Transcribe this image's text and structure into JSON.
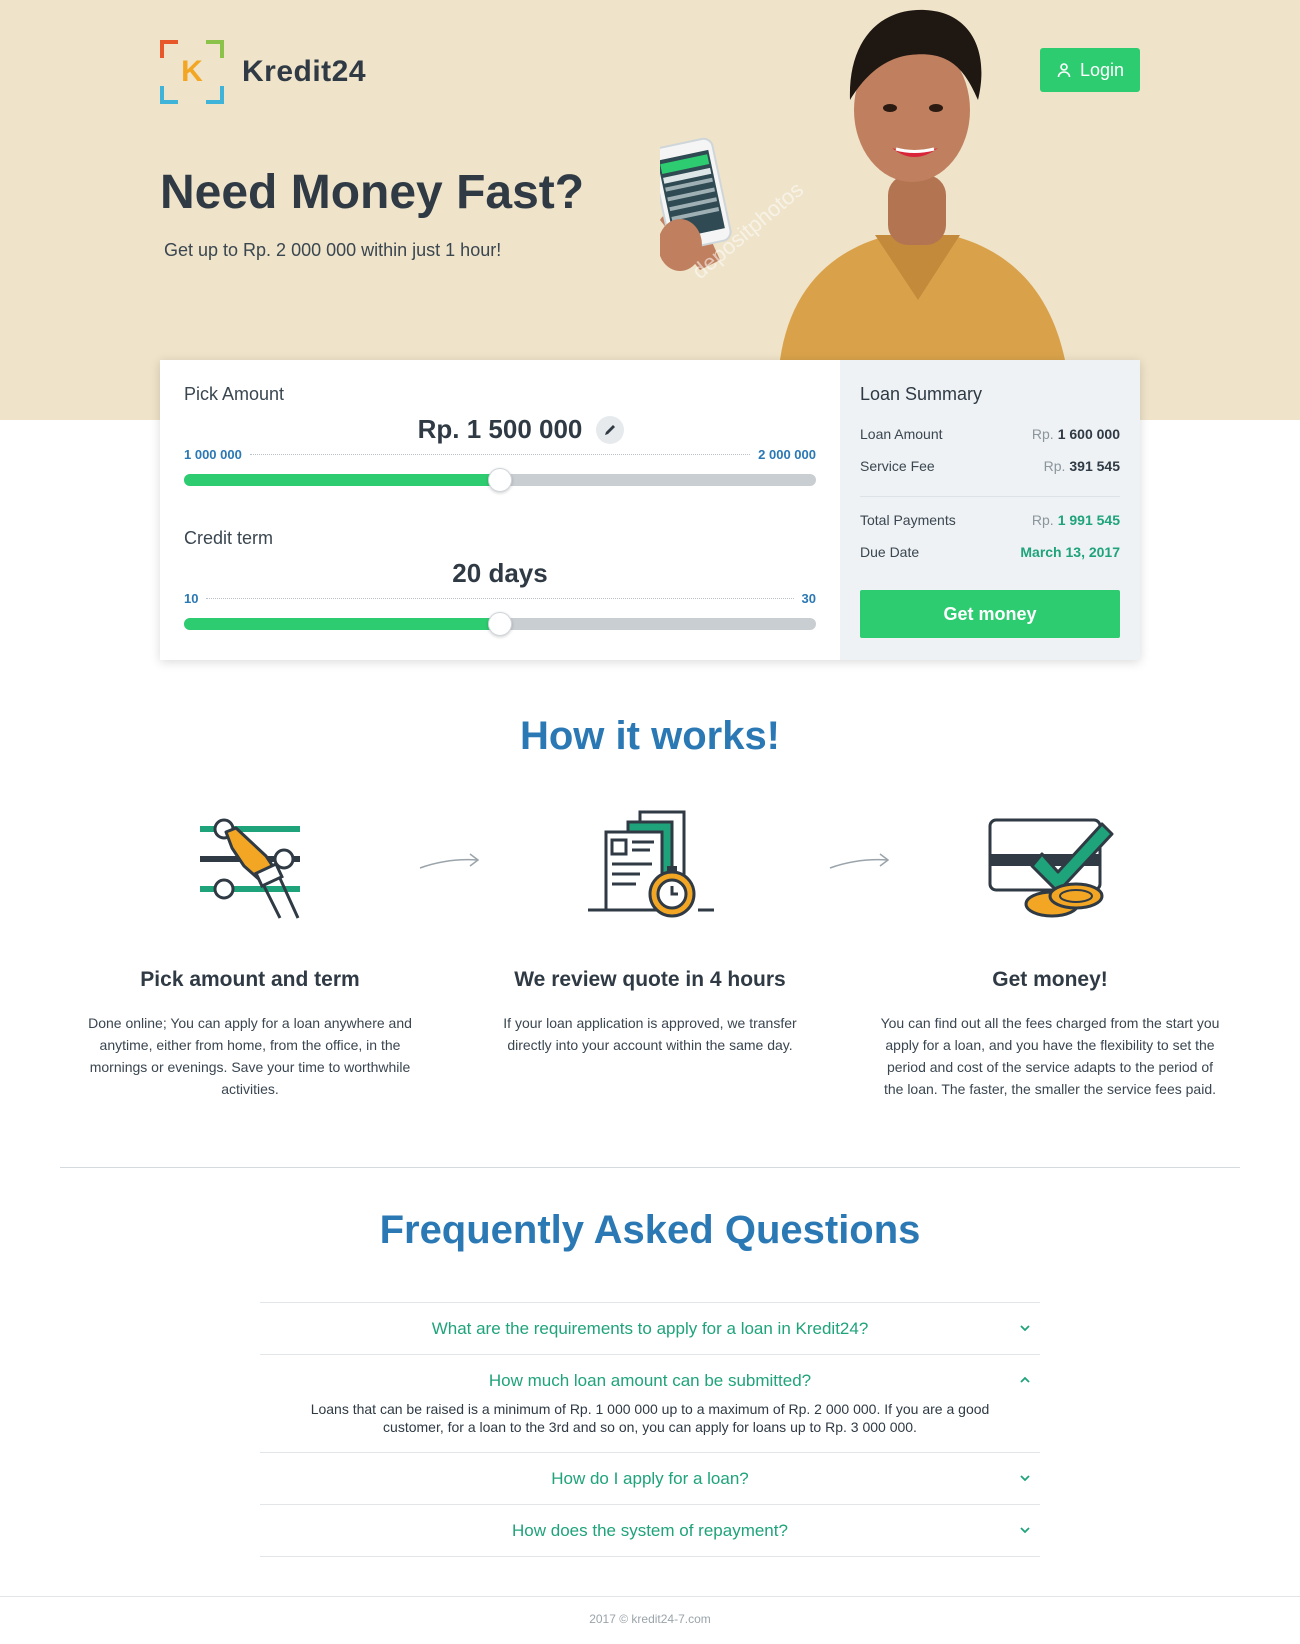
{
  "header": {
    "brand": "Kredit24",
    "logo_letter": "K",
    "login_label": "Login"
  },
  "hero": {
    "title": "Need Money Fast?",
    "subtitle": "Get up to Rp. 2 000 000 within just 1 hour!",
    "watermark": "depositphotos"
  },
  "calculator": {
    "amount": {
      "label": "Pick Amount",
      "value": "Rp. 1 500 000",
      "min": "1 000 000",
      "max": "2 000 000",
      "fraction": 0.5
    },
    "term": {
      "label": "Credit term",
      "value": "20 days",
      "min": "10",
      "max": "30",
      "fraction": 0.5
    }
  },
  "summary": {
    "title": "Loan Summary",
    "currency": "Rp.",
    "loan_amount_label": "Loan Amount",
    "loan_amount": "1 600 000",
    "service_fee_label": "Service Fee",
    "service_fee": "391 545",
    "total_label": "Total Payments",
    "total": "1 991 545",
    "due_label": "Due Date",
    "due": "March 13, 2017",
    "button": "Get money"
  },
  "how": {
    "title": "How it works!",
    "steps": [
      {
        "title": "Pick amount and term",
        "text": "Done online; You can apply for a loan anywhere and anytime, either from home, from the office, in the mornings or evenings. Save your time to worthwhile activities.",
        "icon": "slider-hand-icon"
      },
      {
        "title": "We review quote in 4 hours",
        "text": "If your loan application is approved, we transfer directly into your account within the same day.",
        "icon": "document-stopwatch-icon"
      },
      {
        "title": "Get money!",
        "text": "You can find out all the fees charged from the start you apply for a loan, and you have the flexibility to set the period and cost of the service adapts to the period of the loan. The faster, the smaller the service fees paid.",
        "icon": "card-coins-icon"
      }
    ]
  },
  "faq": {
    "title": "Frequently Asked Questions",
    "items": [
      {
        "q": "What are the requirements to apply for a loan in Kredit24?",
        "open": false
      },
      {
        "q": "How much loan amount can be submitted?",
        "open": true,
        "a": "Loans that can be raised is a minimum of Rp. 1 000 000 up to a maximum of Rp. 2 000 000. If you are a good customer, for a loan to the 3rd and so on, you can apply for loans up to Rp. 3 000 000."
      },
      {
        "q": "How do I apply for a loan?",
        "open": false
      },
      {
        "q": "How does the system of repayment?",
        "open": false
      }
    ]
  },
  "footer": {
    "text": "2017 © kredit24-7.com"
  },
  "colors": {
    "accent_green": "#2ecc71",
    "heading_blue": "#2a78b4",
    "hero_bg": "#efe3c9",
    "faq_green": "#1fa37a"
  }
}
